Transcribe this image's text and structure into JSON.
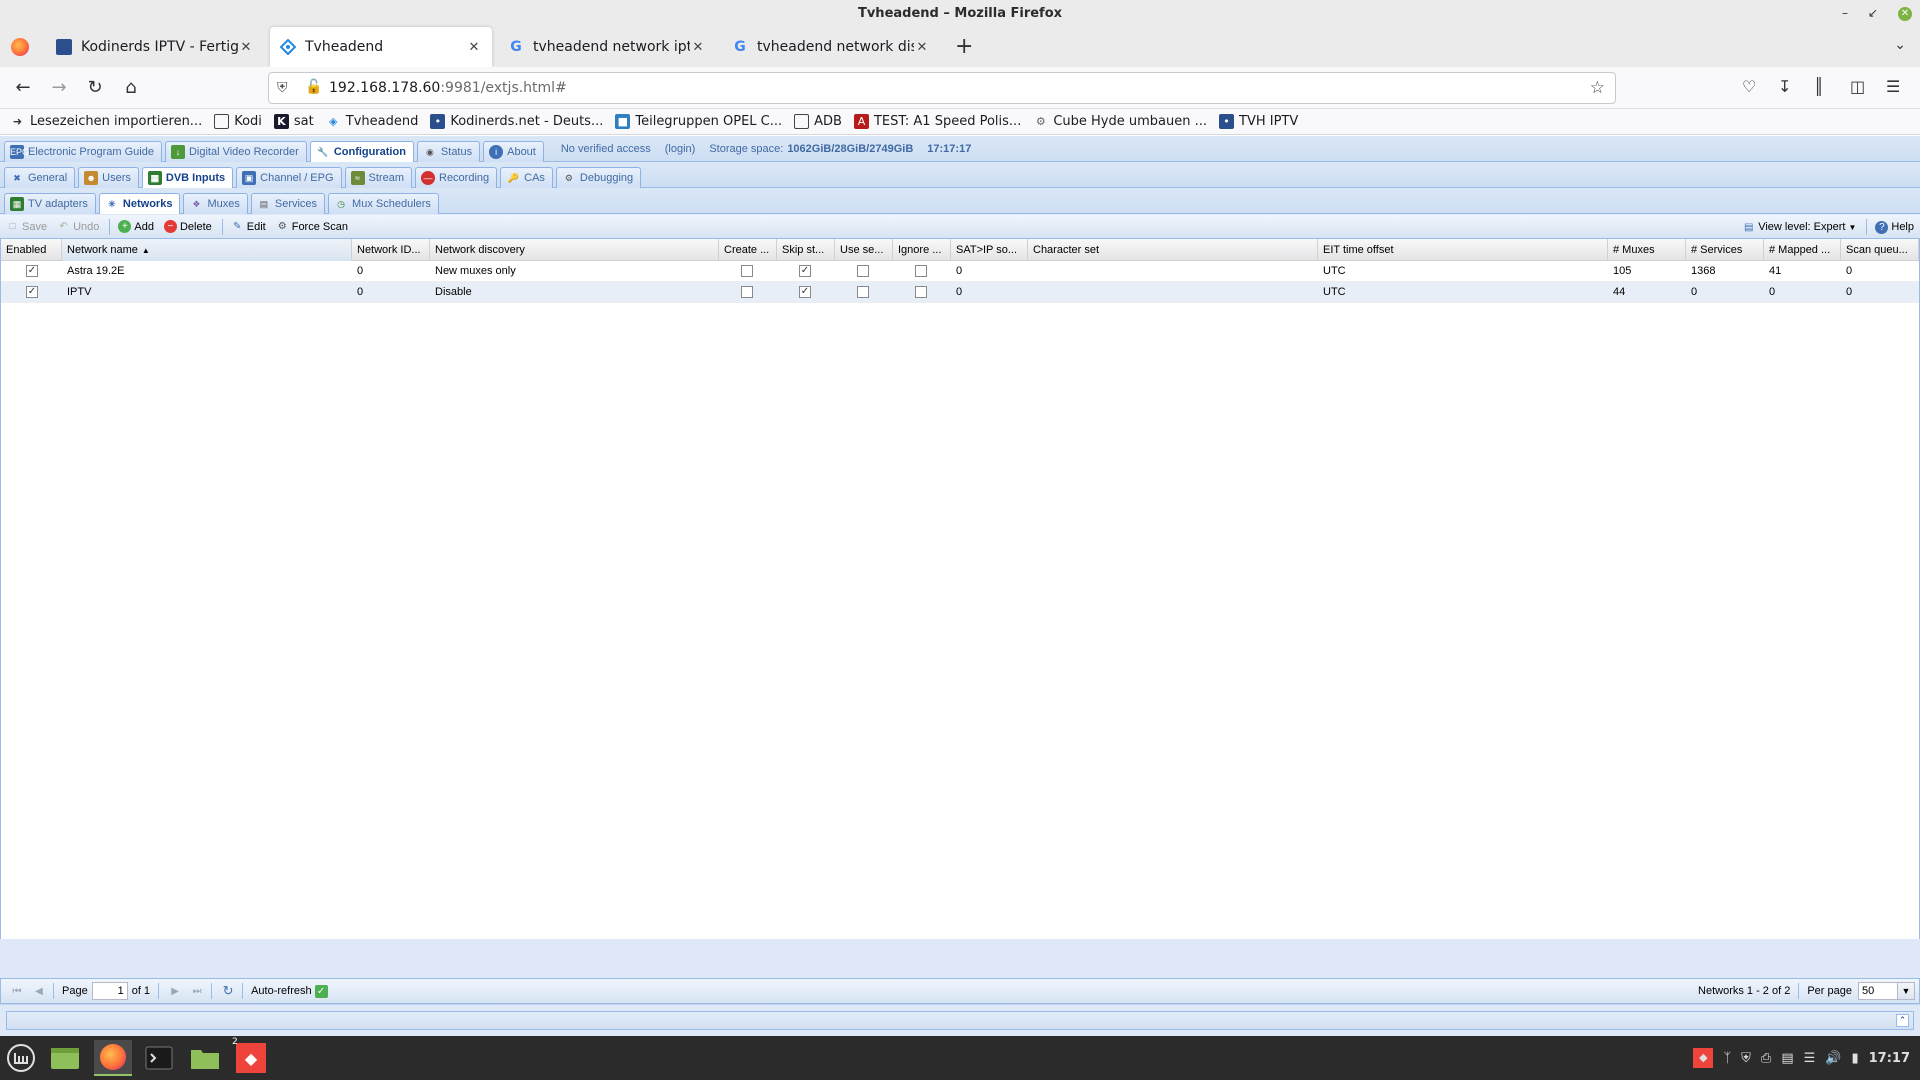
{
  "window": {
    "title": "Tvheadend – Mozilla Firefox"
  },
  "tabs": [
    {
      "title": "Kodinerds IPTV - Fertige Lis",
      "active": false
    },
    {
      "title": "Tvheadend",
      "active": true
    },
    {
      "title": "tvheadend network iptv – G",
      "active": false
    },
    {
      "title": "tvheadend network discove",
      "active": false
    }
  ],
  "urlbar": {
    "host": "192.168.178.60",
    "rest": ":9981/extjs.html#"
  },
  "bookmarks": [
    {
      "label": "Lesezeichen importieren...",
      "icon": "import-icon"
    },
    {
      "label": "Kodi",
      "icon": "folder-icon"
    },
    {
      "label": "sat",
      "icon": "k-icon"
    },
    {
      "label": "Tvheadend",
      "icon": "tvheadend-icon"
    },
    {
      "label": "Kodinerds.net - Deuts...",
      "icon": "kodinerds-icon"
    },
    {
      "label": "Teilegruppen OPEL C...",
      "icon": "opel-icon"
    },
    {
      "label": "ADB",
      "icon": "folder-icon"
    },
    {
      "label": "TEST: A1 Speed Polis...",
      "icon": "a1-icon"
    },
    {
      "label": "Cube Hyde umbauen ...",
      "icon": "cube-icon"
    },
    {
      "label": "TVH IPTV",
      "icon": "kodinerds-icon"
    }
  ],
  "tvh": {
    "main_tabs": [
      {
        "label": "Electronic Program Guide",
        "icon": "epg-icon",
        "active": false
      },
      {
        "label": "Digital Video Recorder",
        "icon": "dvr-icon",
        "active": false
      },
      {
        "label": "Configuration",
        "icon": "wrench-icon",
        "active": true
      },
      {
        "label": "Status",
        "icon": "eye-icon",
        "active": false
      },
      {
        "label": "About",
        "icon": "info-icon",
        "active": false
      }
    ],
    "info": {
      "access": "No verified access",
      "login": "(login)",
      "storage_label": "Storage space:",
      "storage_value": "1062GiB/28GiB/2749GiB",
      "time": "17:17:17"
    },
    "config_tabs": [
      {
        "label": "General",
        "icon": "tools-icon",
        "active": false
      },
      {
        "label": "Users",
        "icon": "users-icon",
        "active": false
      },
      {
        "label": "DVB Inputs",
        "icon": "dvb-card-icon",
        "active": true
      },
      {
        "label": "Channel / EPG",
        "icon": "tv-icon",
        "active": false
      },
      {
        "label": "Stream",
        "icon": "stream-icon",
        "active": false
      },
      {
        "label": "Recording",
        "icon": "record-icon",
        "active": false
      },
      {
        "label": "CAs",
        "icon": "key-icon",
        "active": false
      },
      {
        "label": "Debugging",
        "icon": "bug-icon",
        "active": false
      }
    ],
    "dvb_tabs": [
      {
        "label": "TV adapters",
        "icon": "adapter-icon",
        "active": false
      },
      {
        "label": "Networks",
        "icon": "network-icon",
        "active": true
      },
      {
        "label": "Muxes",
        "icon": "mux-icon",
        "active": false
      },
      {
        "label": "Services",
        "icon": "services-icon",
        "active": false
      },
      {
        "label": "Mux Schedulers",
        "icon": "scheduler-icon",
        "active": false
      }
    ],
    "toolbar": {
      "save": "Save",
      "undo": "Undo",
      "add": "Add",
      "delete": "Delete",
      "edit": "Edit",
      "force_scan": "Force Scan",
      "view_level": "View level: Expert",
      "help": "Help"
    },
    "columns": [
      "Enabled",
      "Network name",
      "Network ID...",
      "Network discovery",
      "Create ...",
      "Skip st...",
      "Use se...",
      "Ignore ...",
      "SAT>IP so...",
      "Character set",
      "EIT time offset",
      "# Muxes",
      "# Services",
      "# Mapped ...",
      "Scan queu..."
    ],
    "rows": [
      {
        "enabled": true,
        "name": "Astra 19.2E",
        "network_id": "0",
        "discovery": "New muxes only",
        "create": false,
        "skip": true,
        "use": false,
        "ignore": false,
        "satip": "0",
        "charset": "",
        "eit": "UTC",
        "muxes": "105",
        "services": "1368",
        "mapped": "41",
        "scanq": "0"
      },
      {
        "enabled": true,
        "name": "IPTV",
        "network_id": "0",
        "discovery": "Disable",
        "create": false,
        "skip": true,
        "use": false,
        "ignore": false,
        "satip": "0",
        "charset": "",
        "eit": "UTC",
        "muxes": "44",
        "services": "0",
        "mapped": "0",
        "scanq": "0"
      }
    ],
    "pager": {
      "page_label": "Page",
      "page_value": "1",
      "of_label": "of 1",
      "auto_refresh": "Auto-refresh",
      "summary": "Networks 1 - 2 of 2",
      "per_page_label": "Per page",
      "per_page_value": "50"
    }
  },
  "taskbar": {
    "clock": "17:17",
    "badge": "2"
  }
}
